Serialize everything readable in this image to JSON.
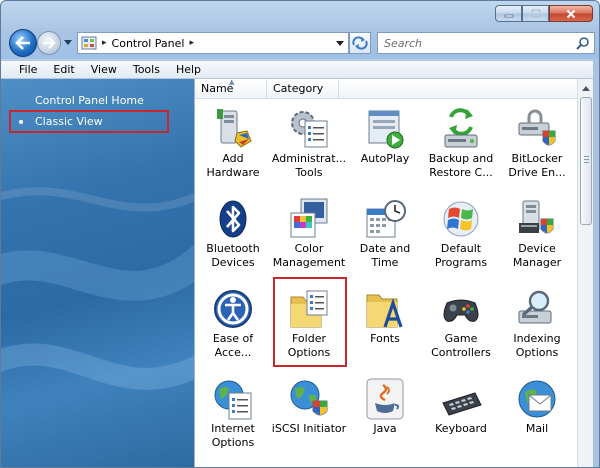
{
  "window": {
    "address_crumb": "Control Panel",
    "search_placeholder": "Search"
  },
  "menu": [
    "File",
    "Edit",
    "View",
    "Tools",
    "Help"
  ],
  "left_pane": {
    "home_link": "Control Panel Home",
    "classic_view": "Classic View"
  },
  "columns": {
    "name": "Name",
    "category": "Category"
  },
  "items": [
    {
      "label": "Add Hardware",
      "icon": "add-hardware-icon"
    },
    {
      "label": "Administrat... Tools",
      "icon": "administrative-tools-icon"
    },
    {
      "label": "AutoPlay",
      "icon": "autoplay-icon"
    },
    {
      "label": "Backup and Restore C...",
      "icon": "backup-restore-icon"
    },
    {
      "label": "BitLocker Drive En...",
      "icon": "bitlocker-icon"
    },
    {
      "label": "Bluetooth Devices",
      "icon": "bluetooth-icon"
    },
    {
      "label": "Color Management",
      "icon": "color-management-icon"
    },
    {
      "label": "Date and Time",
      "icon": "date-time-icon"
    },
    {
      "label": "Default Programs",
      "icon": "default-programs-icon"
    },
    {
      "label": "Device Manager",
      "icon": "device-manager-icon"
    },
    {
      "label": "Ease of Acce...",
      "icon": "ease-of-access-icon"
    },
    {
      "label": "Folder Options",
      "icon": "folder-options-icon"
    },
    {
      "label": "Fonts",
      "icon": "fonts-icon"
    },
    {
      "label": "Game Controllers",
      "icon": "game-controllers-icon"
    },
    {
      "label": "Indexing Options",
      "icon": "indexing-options-icon"
    },
    {
      "label": "Internet Options",
      "icon": "internet-options-icon"
    },
    {
      "label": "iSCSI Initiator",
      "icon": "iscsi-initiator-icon"
    },
    {
      "label": "Java",
      "icon": "java-icon"
    },
    {
      "label": "Keyboard",
      "icon": "keyboard-icon"
    },
    {
      "label": "Mail",
      "icon": "mail-icon"
    }
  ],
  "colors": {
    "highlight_border": "#c9272b",
    "left_pane_blue": "#3573ae"
  }
}
